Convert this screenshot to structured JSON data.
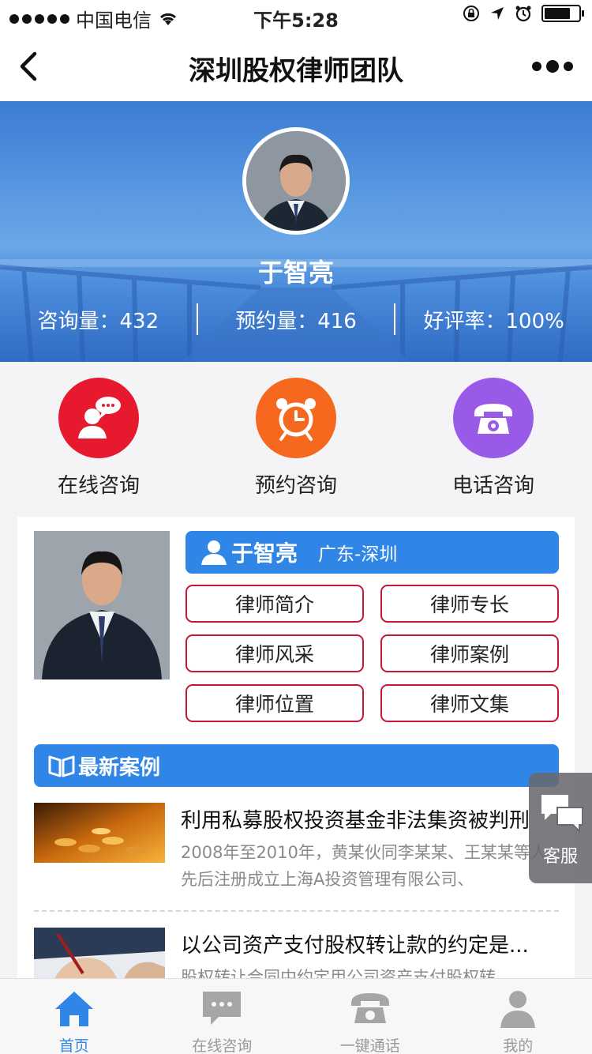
{
  "status_bar": {
    "carrier": "中国电信",
    "time": "下午5:28",
    "battery_level": 0.75
  },
  "nav": {
    "title": "深圳股权律师团队",
    "back_icon": "chevron-left-icon",
    "more_icon": "more-dots-icon"
  },
  "hero": {
    "name": "于智亮",
    "stats": [
      {
        "label": "咨询量：432"
      },
      {
        "label": "预约量：416"
      },
      {
        "label": "好评率：100%"
      }
    ]
  },
  "actions": [
    {
      "label": "在线咨询",
      "icon": "chat-person-icon",
      "color": "#e6192f"
    },
    {
      "label": "预约咨询",
      "icon": "alarm-clock-icon",
      "color": "#f5681e"
    },
    {
      "label": "电话咨询",
      "icon": "telephone-icon",
      "color": "#9a5ae8"
    }
  ],
  "card": {
    "name": "于智亮",
    "location": "广东-深圳",
    "buttons": [
      "律师简介",
      "律师专长",
      "律师风采",
      "律师案例",
      "律师位置",
      "律师文集"
    ]
  },
  "cases_section": {
    "title": "最新案例",
    "items": [
      {
        "title": "利用私募股权投资基金非法集资被判刑",
        "desc": "2008年至2010年，黄某伙同李某某、王某某等人先后注册成立上海A投资管理有限公司、"
      },
      {
        "title": "以公司资产支付股权转让款的约定是...",
        "desc": "股权转让合同中约定用公司资产支付股权转"
      }
    ]
  },
  "float_service": {
    "label": "客服",
    "icon": "chat-bubbles-icon"
  },
  "tab_bar": {
    "items": [
      {
        "label": "首页",
        "icon": "home-icon",
        "active": true
      },
      {
        "label": "在线咨询",
        "icon": "message-icon",
        "active": false
      },
      {
        "label": "一键通话",
        "icon": "phone-icon",
        "active": false
      },
      {
        "label": "我的",
        "icon": "user-icon",
        "active": false
      }
    ]
  },
  "colors": {
    "accent": "#2f86e6",
    "pill_border": "#c8163b",
    "hero_blue": "#3d7fd6"
  }
}
